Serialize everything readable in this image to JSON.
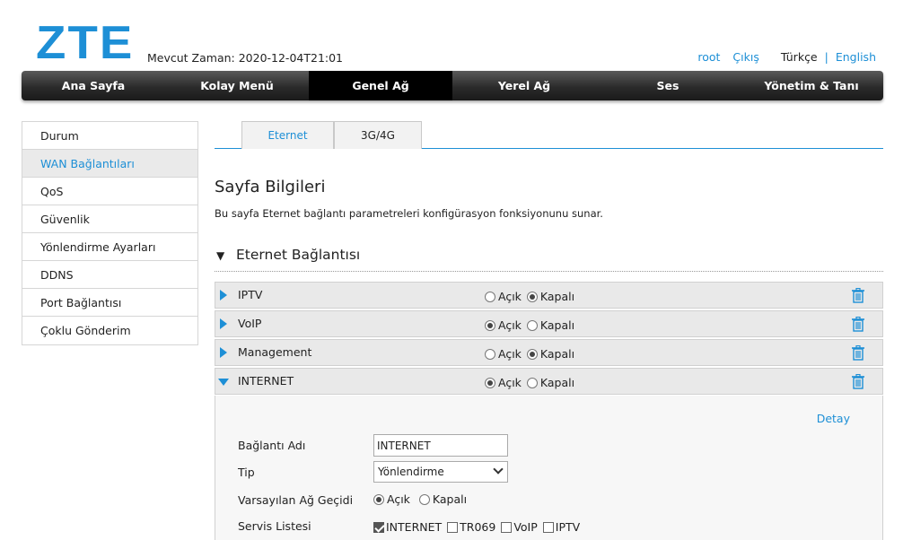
{
  "header": {
    "logo": "ZTE",
    "time_label": "Mevcut Zaman: 2020-12-04T21:01",
    "user": "root",
    "logout": "Çıkış",
    "lang_current": "Türkçe",
    "lang_sep": "|",
    "lang_other": "English"
  },
  "nav": [
    "Ana Sayfa",
    "Kolay Menü",
    "Genel Ağ",
    "Yerel Ağ",
    "Ses",
    "Yönetim & Tanı"
  ],
  "sidebar": [
    "Durum",
    "WAN Bağlantıları",
    "QoS",
    "Güvenlik",
    "Yönlendirme Ayarları",
    "DDNS",
    "Port Bağlantısı",
    "Çoklu Gönderim"
  ],
  "tabs": [
    "Eternet",
    "3G/4G"
  ],
  "page": {
    "title": "Sayfa Bilgileri",
    "description": "Bu sayfa Eternet bağlantı parametreleri konfigürasyon fonksiyonunu sunar.",
    "section_title": "Eternet Bağlantısı"
  },
  "radio_labels": {
    "on": "Açık",
    "off": "Kapalı"
  },
  "connections": [
    {
      "name": "IPTV",
      "state": "off"
    },
    {
      "name": "VoIP",
      "state": "on"
    },
    {
      "name": "Management",
      "state": "off"
    },
    {
      "name": "INTERNET",
      "state": "on"
    }
  ],
  "detail": {
    "detay_link": "Detay",
    "conn_name_label": "Bağlantı Adı",
    "conn_name_value": "INTERNET",
    "type_label": "Tip",
    "type_value": "Yönlendirme",
    "gateway_label": "Varsayılan Ağ Geçidi",
    "gateway_on": "Açık",
    "gateway_off": "Kapalı",
    "service_label": "Servis Listesi",
    "services": [
      {
        "name": "INTERNET",
        "checked": true
      },
      {
        "name": "TR069",
        "checked": false
      },
      {
        "name": "VoIP",
        "checked": false
      },
      {
        "name": "IPTV",
        "checked": false
      }
    ]
  },
  "colors": {
    "accent": "#1d8fd6",
    "nav_dark": "#2b2b2b"
  }
}
